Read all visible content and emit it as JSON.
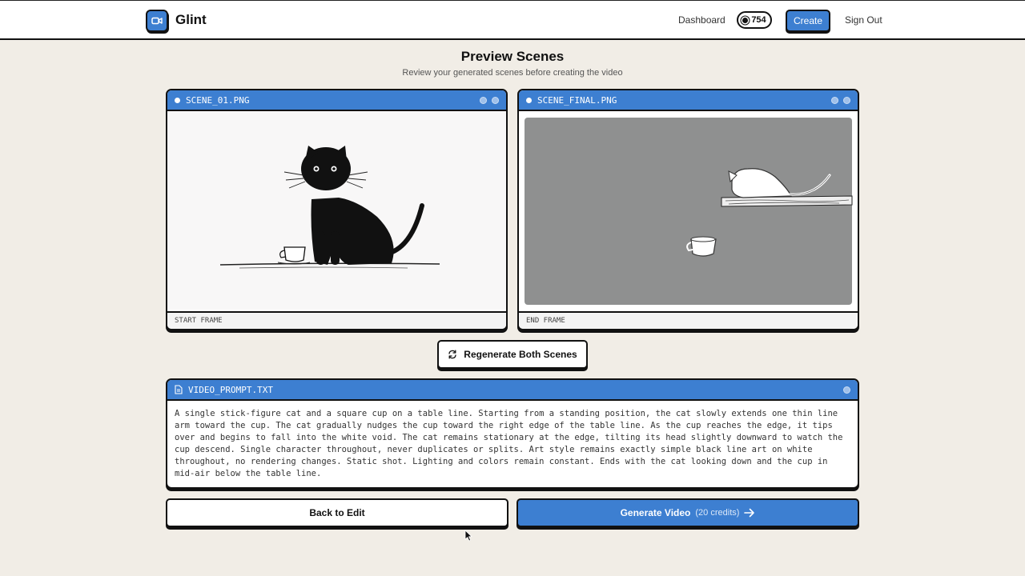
{
  "header": {
    "logo_text": "Glint",
    "logo_icon": "video-camera-icon",
    "nav_dashboard": "Dashboard",
    "credits": "754",
    "create_label": "Create",
    "signout_label": "Sign Out"
  },
  "page": {
    "title": "Preview Scenes",
    "subtitle": "Review your generated scenes before creating the video"
  },
  "scenes": [
    {
      "filename": "SCENE_01.PNG",
      "footer": "START FRAME"
    },
    {
      "filename": "SCENE_FINAL.PNG",
      "footer": "END FRAME"
    }
  ],
  "regenerate_label": "Regenerate Both Scenes",
  "prompt": {
    "filename": "VIDEO_PROMPT.TXT",
    "lines": [
      "A single stick-figure cat and a square cup on a table line. Starting from a standing position, the cat slowly extends one thin line",
      "arm toward the cup. The cat gradually nudges the cup toward the right edge of the table line. As the cup reaches the edge, it tips",
      "over and begins to fall into the white void. The cat remains stationary at the edge, tilting its head slightly downward to watch the",
      "cup descend. Single character throughout, never duplicates or splits. Art style remains exactly simple black line art on white",
      "throughout, no rendering changes. Static shot. Lighting and colors remain constant. Ends with the cat looking down and the cup in",
      "mid-air below the table line."
    ]
  },
  "actions": {
    "back_label": "Back to Edit",
    "generate_label": "Generate Video",
    "generate_credits": "(20 credits)"
  },
  "colors": {
    "accent": "#3d7fd1",
    "background": "#f1ede6",
    "border": "#111111"
  }
}
